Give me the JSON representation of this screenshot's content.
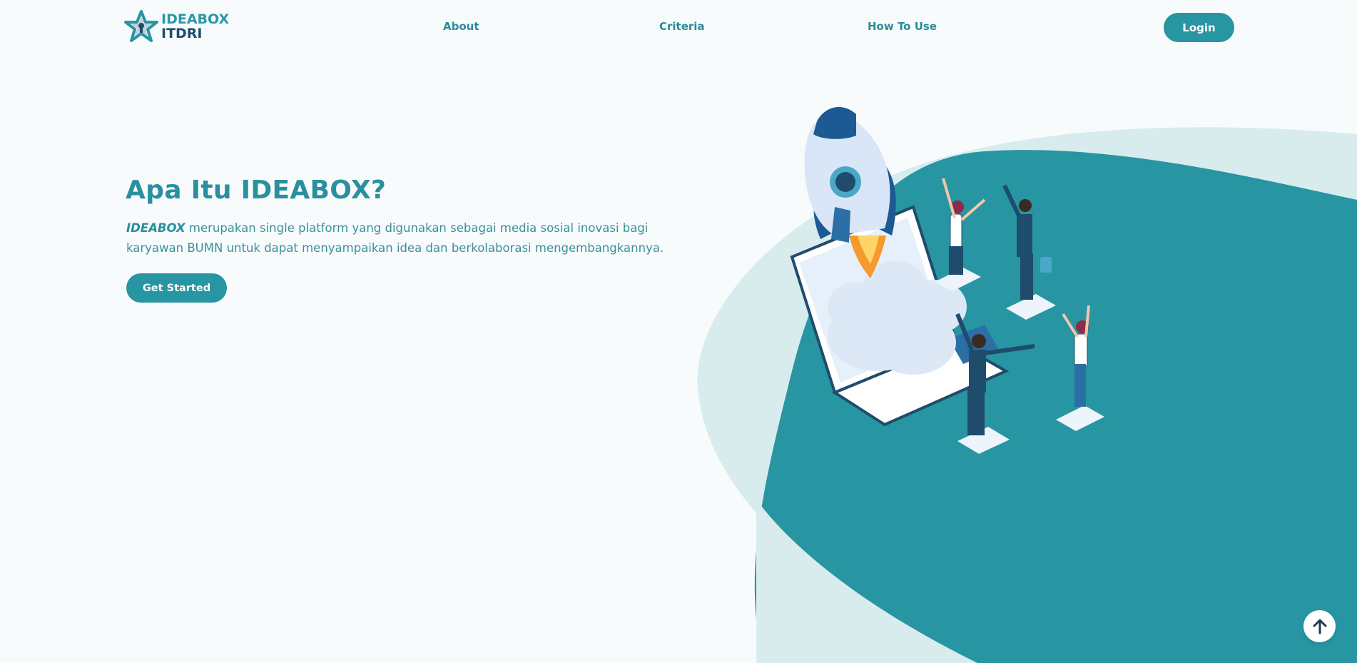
{
  "brand": {
    "line1": "IDEABOX",
    "line2": "ITDRI",
    "logo_icon": "star-icon",
    "accent_color": "#2895a3",
    "dark_color": "#1f4c6b"
  },
  "nav": {
    "links": [
      {
        "label": "About"
      },
      {
        "label": "Criteria"
      },
      {
        "label": "How To Use"
      }
    ],
    "login_label": "Login"
  },
  "hero": {
    "title": "Apa Itu IDEABOX?",
    "brand_word": "IDEABOX",
    "description": " merupakan single platform yang digunakan sebagai media sosial inovasi bagi karyawan BUMN untuk dapat menyampaikan idea dan berkolaborasi mengembangkannya.",
    "cta_label": "Get Started",
    "illustration": "rocket-launch-team-illustration"
  },
  "scroll_top": {
    "icon": "arrow-up-icon"
  }
}
